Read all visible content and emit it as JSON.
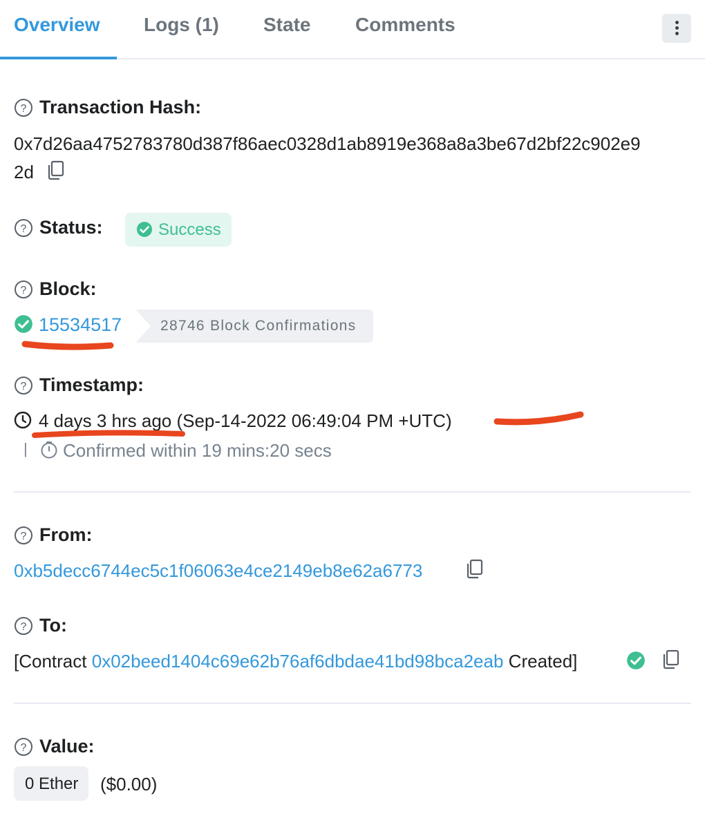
{
  "tabs": [
    {
      "label": "Overview",
      "active": true
    },
    {
      "label": "Logs (1)",
      "active": false
    },
    {
      "label": "State",
      "active": false
    },
    {
      "label": "Comments",
      "active": false
    }
  ],
  "fields": {
    "tx_hash": {
      "label": "Transaction Hash:",
      "value_line1": "0x7d26aa4752783780d387f86aec0328d1ab8919e368a8a3be67d2bf22c902e9",
      "value_line2": "2d"
    },
    "status": {
      "label": "Status:",
      "value": "Success"
    },
    "block": {
      "label": "Block:",
      "number": "15534517",
      "confirmations": "28746 Block Confirmations"
    },
    "timestamp": {
      "label": "Timestamp:",
      "relative": "4 days 3 hrs ago",
      "absolute": "(Sep-14-2022 06:49:04 PM +UTC)",
      "separator": "|",
      "confirmed": "Confirmed within 19 mins:20 secs"
    },
    "from": {
      "label": "From:",
      "address": "0xb5decc6744ec5c1f06063e4ce2149eb8e62a6773"
    },
    "to": {
      "label": "To:",
      "prefix": "[Contract",
      "address": "0x02beed1404c69e62b76af6dbdae41bd98bca2eab",
      "suffix": "Created]"
    },
    "value": {
      "label": "Value:",
      "amount": "0 Ether",
      "usd": "($0.00)"
    }
  },
  "colors": {
    "accent": "#3498db",
    "success": "#3fbf91",
    "success_bg": "#e3f6ef",
    "annotation": "#e8461e"
  }
}
